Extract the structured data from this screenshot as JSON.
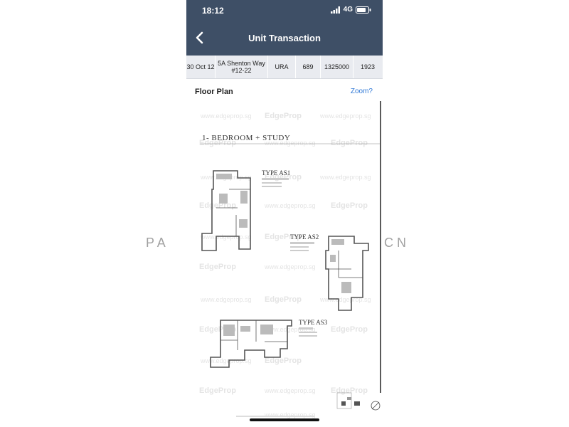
{
  "status_bar": {
    "time": "18:12",
    "network": "4G"
  },
  "nav": {
    "title": "Unit Transaction"
  },
  "transaction": {
    "date": "30 Oct 12",
    "address_line1": "5A Shenton Way",
    "address_line2": "#12-22",
    "source": "URA",
    "area": "689",
    "price": "1325000",
    "psf": "1923"
  },
  "floor_plan": {
    "label": "Floor Plan",
    "zoom_link": "Zoom?",
    "heading": "1- BEDROOM + STUDY",
    "types": [
      "TYPE AS1",
      "TYPE AS2",
      "TYPE AS3"
    ],
    "watermark": "EdgeProp",
    "watermark_url": "www.edgeprop.sg"
  },
  "background_watermark": {
    "left": "P   A",
    "right": "C   N"
  },
  "colors": {
    "header": "#3e4f66",
    "accent": "#2f78d6",
    "row_bg": "#e9ebf0"
  }
}
